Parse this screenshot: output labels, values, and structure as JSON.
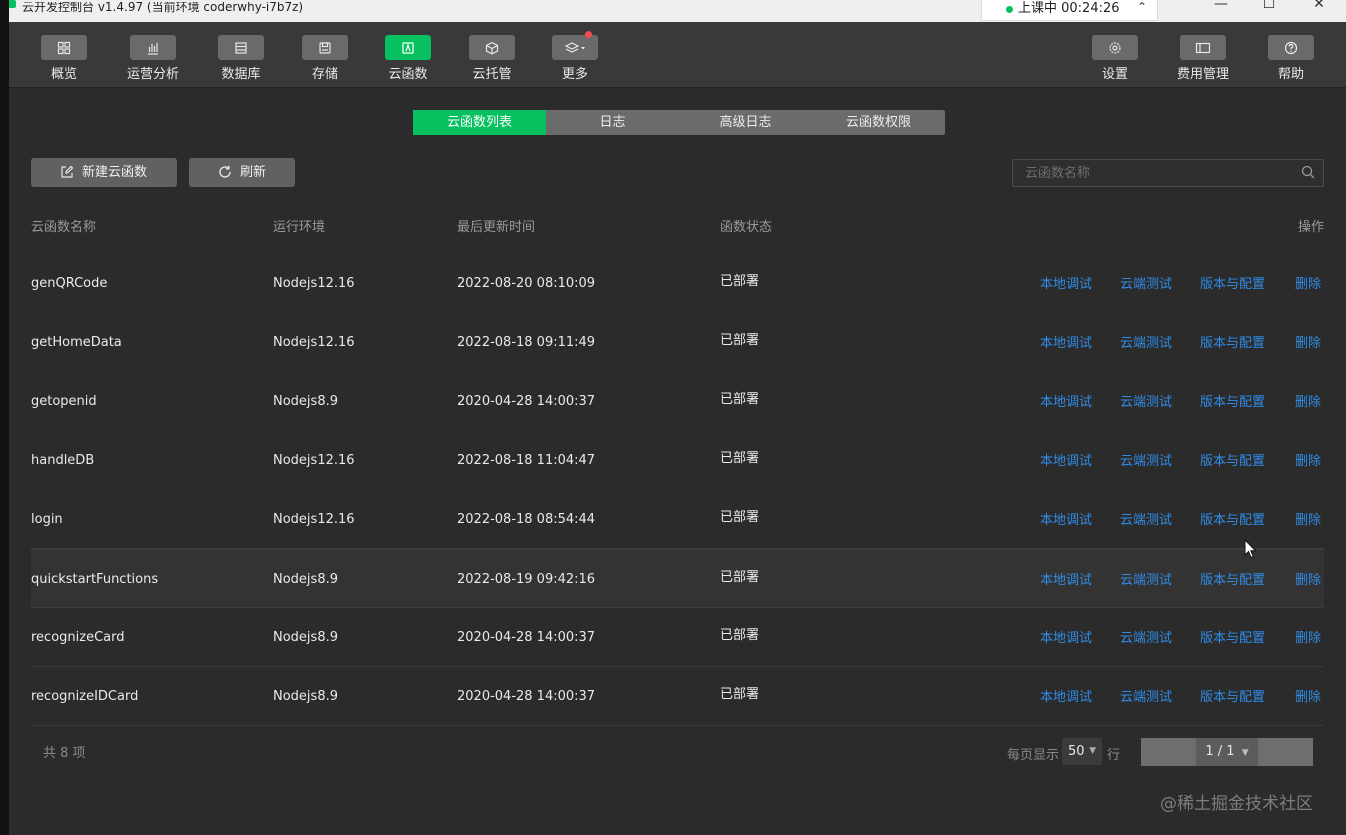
{
  "titlebar": {
    "title": "云开发控制台 v1.4.97 (当前环境 coderwhy-i7b7z)",
    "live_status": "上课中 00:24:26"
  },
  "toolbar": {
    "left": [
      {
        "label": "概览",
        "icon": "grid-icon"
      },
      {
        "label": "运营分析",
        "icon": "bar-chart-icon"
      },
      {
        "label": "数据库",
        "icon": "database-icon"
      },
      {
        "label": "存储",
        "icon": "storage-icon"
      },
      {
        "label": "云函数",
        "icon": "function-icon"
      },
      {
        "label": "云托管",
        "icon": "cube-icon"
      },
      {
        "label": "更多",
        "icon": "layers-icon"
      }
    ],
    "right": [
      {
        "label": "设置",
        "icon": "gear-icon"
      },
      {
        "label": "费用管理",
        "icon": "billing-icon"
      },
      {
        "label": "帮助",
        "icon": "help-icon"
      }
    ]
  },
  "tabs": [
    "云函数列表",
    "日志",
    "高级日志",
    "云函数权限"
  ],
  "actions": {
    "new_label": "新建云函数",
    "refresh_label": "刷新"
  },
  "search": {
    "placeholder": "云函数名称"
  },
  "table": {
    "headers": {
      "name": "云函数名称",
      "runtime": "运行环境",
      "updated": "最后更新时间",
      "status": "函数状态",
      "ops": "操作"
    },
    "actions": [
      "本地调试",
      "云端测试",
      "版本与配置",
      "删除"
    ],
    "rows": [
      {
        "name": "genQRCode",
        "runtime": "Nodejs12.16",
        "updated": "2022-08-20 08:10:09",
        "status": "已部署"
      },
      {
        "name": "getHomeData",
        "runtime": "Nodejs12.16",
        "updated": "2022-08-18 09:11:49",
        "status": "已部署"
      },
      {
        "name": "getopenid",
        "runtime": "Nodejs8.9",
        "updated": "2020-04-28 14:00:37",
        "status": "已部署"
      },
      {
        "name": "handleDB",
        "runtime": "Nodejs12.16",
        "updated": "2022-08-18 11:04:47",
        "status": "已部署"
      },
      {
        "name": "login",
        "runtime": "Nodejs12.16",
        "updated": "2022-08-18 08:54:44",
        "status": "已部署"
      },
      {
        "name": "quickstartFunctions",
        "runtime": "Nodejs8.9",
        "updated": "2022-08-19 09:42:16",
        "status": "已部署"
      },
      {
        "name": "recognizeCard",
        "runtime": "Nodejs8.9",
        "updated": "2020-04-28 14:00:37",
        "status": "已部署"
      },
      {
        "name": "recognizeIDCard",
        "runtime": "Nodejs8.9",
        "updated": "2020-04-28 14:00:37",
        "status": "已部署"
      }
    ]
  },
  "footer": {
    "total": "共 8 项",
    "per_page_label": "每页显示",
    "per_page_value": "50",
    "row_unit": "行",
    "page": "1 / 1"
  },
  "watermark": "@稀土掘金技术社区",
  "colors": {
    "accent": "#07c160",
    "link": "#2f8ce8",
    "background": "#2b2b2b"
  }
}
